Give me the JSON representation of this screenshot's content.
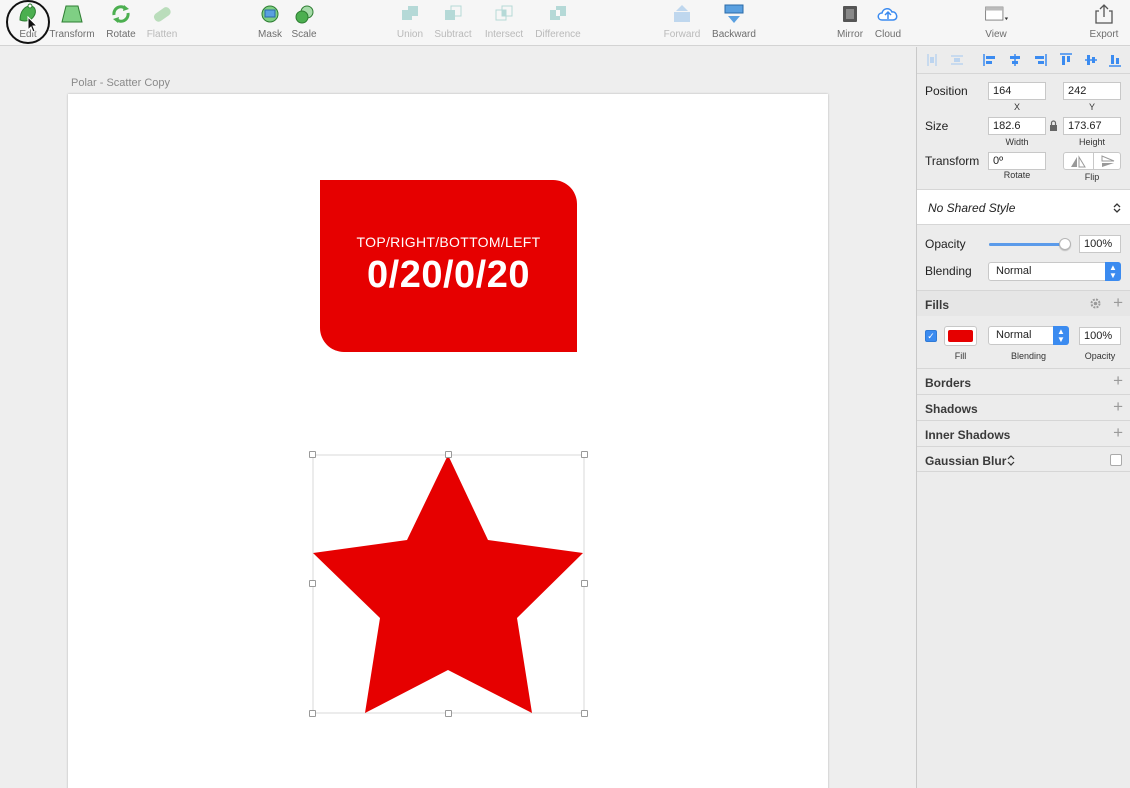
{
  "toolbar": {
    "edit": "Edit",
    "transform": "Transform",
    "rotate": "Rotate",
    "flatten": "Flatten",
    "mask": "Mask",
    "scale": "Scale",
    "union": "Union",
    "subtract": "Subtract",
    "intersect": "Intersect",
    "difference": "Difference",
    "forward": "Forward",
    "backward": "Backward",
    "mirror": "Mirror",
    "cloud": "Cloud",
    "view": "View",
    "export": "Export"
  },
  "canvas": {
    "artboard_name": "Polar - Scatter Copy",
    "box_line1": "TOP/RIGHT/BOTTOM/LEFT",
    "box_line2": "0/20/0/20"
  },
  "inspector": {
    "position_label": "Position",
    "x_value": "164",
    "x_label": "X",
    "y_value": "242",
    "y_label": "Y",
    "size_label": "Size",
    "width_value": "182.6",
    "width_label": "Width",
    "height_value": "173.67",
    "height_label": "Height",
    "transform_label": "Transform",
    "rotate_value": "0º",
    "rotate_label": "Rotate",
    "flip_label": "Flip",
    "shared_style": "No Shared Style",
    "opacity_label": "Opacity",
    "opacity_value": "100%",
    "opacity_level": 1.0,
    "blending_label": "Blending",
    "blending_value": "Normal",
    "fills_title": "Fills",
    "fill_label": "Fill",
    "fill_color": "#e60000",
    "fill_blending_value": "Normal",
    "fill_blending_label": "Blending",
    "fill_opacity_value": "100%",
    "fill_opacity_label": "Opacity",
    "borders_title": "Borders",
    "shadows_title": "Shadows",
    "inner_shadows_title": "Inner Shadows",
    "gaussian_blur_title": "Gaussian Blur"
  },
  "colors": {
    "shape_red": "#e60000",
    "accent_blue": "#3b8bf0"
  }
}
